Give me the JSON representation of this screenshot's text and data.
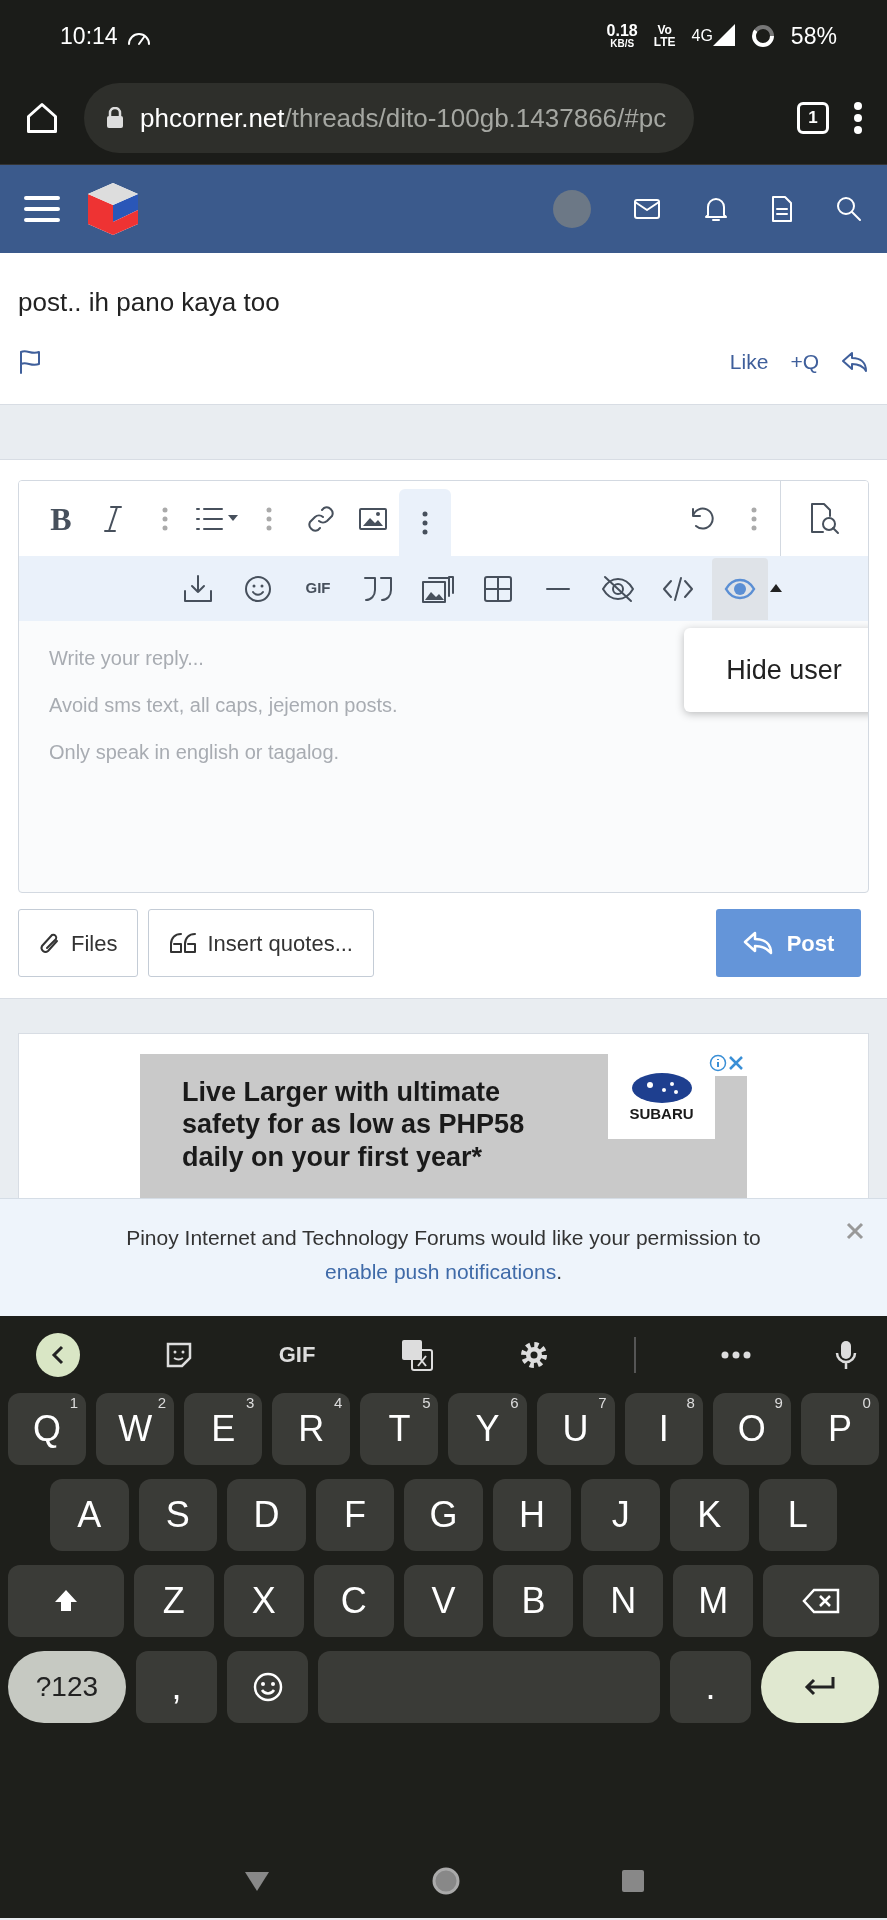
{
  "status_bar": {
    "time": "10:14",
    "speed_value": "0.18",
    "speed_unit": "KB/S",
    "volte_top": "Vo",
    "volte_bottom": "LTE",
    "network": "4G",
    "battery": "58%"
  },
  "browser": {
    "url_domain": "phcorner.net",
    "url_path": "/threads/dito-100gb.1437866/#pc",
    "tab_count": "1"
  },
  "post": {
    "text": "post.. ih pano kaya too",
    "actions": [
      "Like",
      "+Q"
    ]
  },
  "editor": {
    "bold_label": "B",
    "gif_label": "GIF",
    "preview_selected": false,
    "eye_selected": true,
    "placeholder_lines": [
      "Write your reply...",
      "Avoid sms text, all caps, jejemon posts.",
      "Only speak in english or tagalog."
    ],
    "menu_items": [
      "Hide user"
    ],
    "files_button": "Files",
    "quotes_button": "Insert quotes...",
    "post_button": "Post"
  },
  "ad": {
    "headline": [
      "Live Larger with ultimate",
      "safety for as low as PHP58",
      "daily on your first year*"
    ],
    "brand": "SUBARU"
  },
  "push_notice": {
    "text": "Pinoy Internet and Technology Forums would like your permission to",
    "link": "enable push notifications",
    "end": "."
  },
  "keyboard": {
    "gif_label": "GIF",
    "rows": [
      [
        {
          "kind": "letter",
          "label": "Q",
          "hint": "1"
        },
        {
          "kind": "letter",
          "label": "W",
          "hint": "2"
        },
        {
          "kind": "letter",
          "label": "E",
          "hint": "3"
        },
        {
          "kind": "letter",
          "label": "R",
          "hint": "4"
        },
        {
          "kind": "letter",
          "label": "T",
          "hint": "5"
        },
        {
          "kind": "letter",
          "label": "Y",
          "hint": "6"
        },
        {
          "kind": "letter",
          "label": "U",
          "hint": "7"
        },
        {
          "kind": "letter",
          "label": "I",
          "hint": "8"
        },
        {
          "kind": "letter",
          "label": "O",
          "hint": "9"
        },
        {
          "kind": "letter",
          "label": "P",
          "hint": "0"
        }
      ],
      [
        {
          "kind": "letter",
          "label": "A"
        },
        {
          "kind": "letter",
          "label": "S"
        },
        {
          "kind": "letter",
          "label": "D"
        },
        {
          "kind": "letter",
          "label": "F"
        },
        {
          "kind": "letter",
          "label": "G"
        },
        {
          "kind": "letter",
          "label": "H"
        },
        {
          "kind": "letter",
          "label": "J"
        },
        {
          "kind": "letter",
          "label": "K"
        },
        {
          "kind": "letter",
          "label": "L"
        }
      ],
      [
        {
          "kind": "shift"
        },
        {
          "kind": "letter",
          "label": "Z"
        },
        {
          "kind": "letter",
          "label": "X"
        },
        {
          "kind": "letter",
          "label": "C"
        },
        {
          "kind": "letter",
          "label": "V"
        },
        {
          "kind": "letter",
          "label": "B"
        },
        {
          "kind": "letter",
          "label": "N"
        },
        {
          "kind": "letter",
          "label": "M"
        },
        {
          "kind": "backspace"
        }
      ]
    ],
    "bottom_row": {
      "symbols_label": "?123",
      "comma": ",",
      "period": "."
    }
  }
}
